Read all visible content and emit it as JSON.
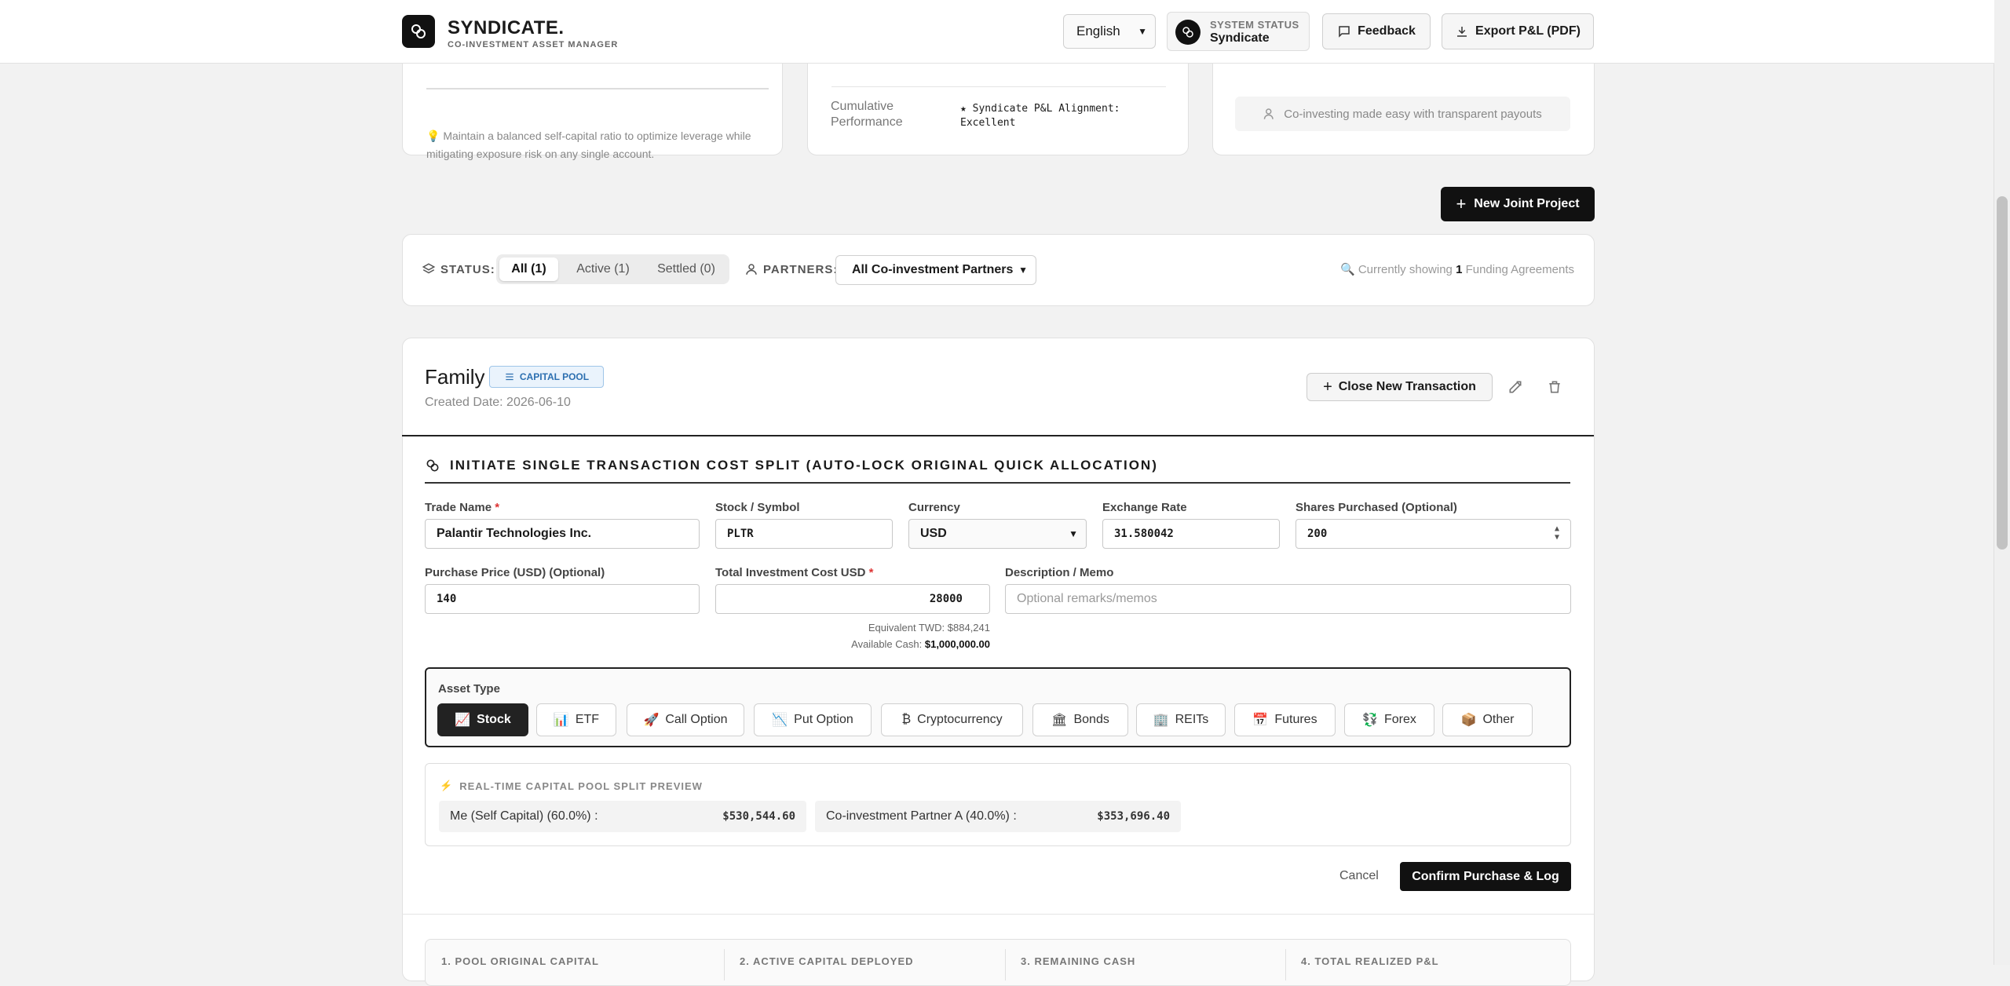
{
  "header": {
    "brand_name": "SYNDICATE.",
    "brand_sub": "CO-INVESTMENT ASSET MANAGER",
    "language": "English",
    "status_label": "SYSTEM STATUS",
    "status_value": "Syndicate",
    "feedback_label": "Feedback",
    "export_label": "Export P&L (PDF)"
  },
  "top_cards": {
    "tip": "💡 Maintain a balanced self-capital ratio to optimize leverage while mitigating exposure risk on any single account.",
    "cumulative_label": "Cumulative Performance",
    "cumulative_value": "★ Syndicate P&L Alignment: Excellent",
    "coinvest_note": "Co-investing made easy with transparent payouts"
  },
  "actions": {
    "new_project_label": "New Joint Project"
  },
  "filters": {
    "status_label": "STATUS:",
    "status_options": [
      "All (1)",
      "Active (1)",
      "Settled (0)"
    ],
    "partners_label": "PARTNERS:",
    "partners_value": "All Co-investment Partners",
    "showing_prefix": "Currently showing",
    "showing_count": "1",
    "showing_suffix": "Funding Agreements"
  },
  "project": {
    "name": "Family",
    "badge": "CAPITAL POOL",
    "created": "Created Date: 2026-06-10",
    "close_txn_label": "Close New Transaction",
    "section_title": "INITIATE SINGLE TRANSACTION COST SPLIT (AUTO-LOCK ORIGINAL QUICK ALLOCATION)",
    "form": {
      "trade_name_label": "Trade Name",
      "trade_name_value": "Palantir Technologies Inc.",
      "symbol_label": "Stock / Symbol",
      "symbol_value": "PLTR",
      "currency_label": "Currency",
      "currency_value": "USD",
      "rate_label": "Exchange Rate",
      "rate_value": "31.580042",
      "shares_label": "Shares Purchased (Optional)",
      "shares_value": "200",
      "price_label": "Purchase Price (USD) (Optional)",
      "price_value": "140",
      "total_label": "Total Investment Cost USD",
      "total_value": "28000",
      "memo_label": "Description / Memo",
      "memo_placeholder": "Optional remarks/memos",
      "equiv_twd": "Equivalent TWD: $884,241",
      "avail_cash_label": "Available Cash:",
      "avail_cash_value": "$1,000,000.00",
      "required_mark": "*"
    },
    "asset_type_label": "Asset Type",
    "asset_types": [
      {
        "icon": "📈",
        "label": "Stock"
      },
      {
        "icon": "📊",
        "label": "ETF"
      },
      {
        "icon": "🚀",
        "label": "Call Option"
      },
      {
        "icon": "📉",
        "label": "Put Option"
      },
      {
        "icon": "₿",
        "label": "Cryptocurrency"
      },
      {
        "icon": "🏛",
        "label": "Bonds"
      },
      {
        "icon": "🏢",
        "label": "REITs"
      },
      {
        "icon": "📅",
        "label": "Futures"
      },
      {
        "icon": "💱",
        "label": "Forex"
      },
      {
        "icon": "📦",
        "label": "Other"
      }
    ],
    "preview_title": "REAL-TIME CAPITAL POOL SPLIT PREVIEW",
    "preview_rows": [
      {
        "label": "Me (Self Capital) (60.0%) :",
        "value": "$530,544.60"
      },
      {
        "label": "Co-investment Partner A (40.0%) :",
        "value": "$353,696.40"
      }
    ],
    "cancel_label": "Cancel",
    "confirm_label": "Confirm Purchase & Log",
    "summary": [
      "1. POOL ORIGINAL CAPITAL",
      "2. ACTIVE CAPITAL DEPLOYED",
      "3. REMAINING CASH",
      "4. TOTAL REALIZED P&L"
    ]
  },
  "colors": {
    "accent": "#111111",
    "badge_blue": "#2c6fb0",
    "required": "#dd3333"
  }
}
